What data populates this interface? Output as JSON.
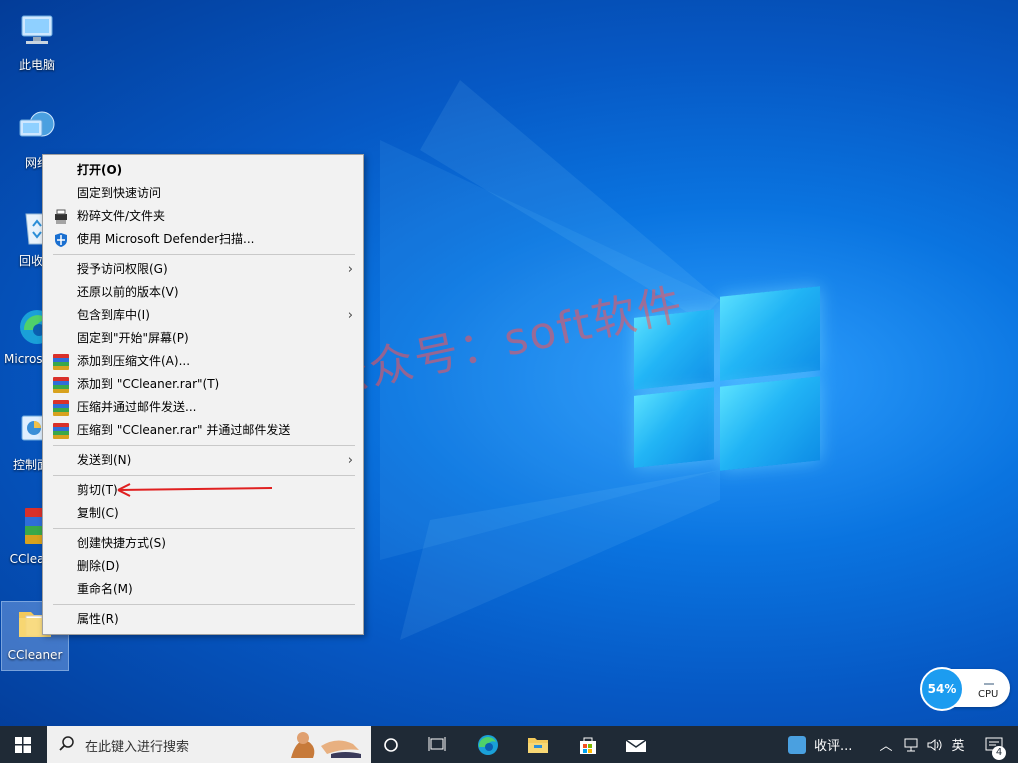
{
  "desktop_icons": [
    {
      "label": "此电脑"
    },
    {
      "label": "网络"
    },
    {
      "label": "回收站"
    },
    {
      "label": "Microsoft Edge"
    },
    {
      "label": "控制面板"
    },
    {
      "label": "CCleaner"
    },
    {
      "label": "CCleaner"
    }
  ],
  "watermark": "微信公众号：soft软件",
  "context_menu": {
    "items": [
      {
        "label": "打开(O)"
      },
      {
        "label": "固定到快速访问"
      },
      {
        "label": "粉碎文件/文件夹"
      },
      {
        "label": "使用 Microsoft Defender扫描..."
      },
      {
        "label": "授予访问权限(G)"
      },
      {
        "label": "还原以前的版本(V)"
      },
      {
        "label": "包含到库中(I)"
      },
      {
        "label": "固定到\"开始\"屏幕(P)"
      },
      {
        "label": "添加到压缩文件(A)..."
      },
      {
        "label": "添加到 \"CCleaner.rar\"(T)"
      },
      {
        "label": "压缩并通过邮件发送..."
      },
      {
        "label": "压缩到 \"CCleaner.rar\" 并通过邮件发送"
      },
      {
        "label": "发送到(N)"
      },
      {
        "label": "剪切(T)"
      },
      {
        "label": "复制(C)"
      },
      {
        "label": "创建快捷方式(S)"
      },
      {
        "label": "删除(D)"
      },
      {
        "label": "重命名(M)"
      },
      {
        "label": "属性(R)"
      }
    ]
  },
  "cpu_widget": {
    "percent": "54%",
    "label": "CPU"
  },
  "taskbar": {
    "search_placeholder": "在此键入进行搜索",
    "tray_app_label": "收评...",
    "ime": "英",
    "notification_count": "4"
  },
  "colors": {
    "accent": "#0a74e0",
    "taskbar": "#1f2a36",
    "arrow": "#e02020"
  }
}
